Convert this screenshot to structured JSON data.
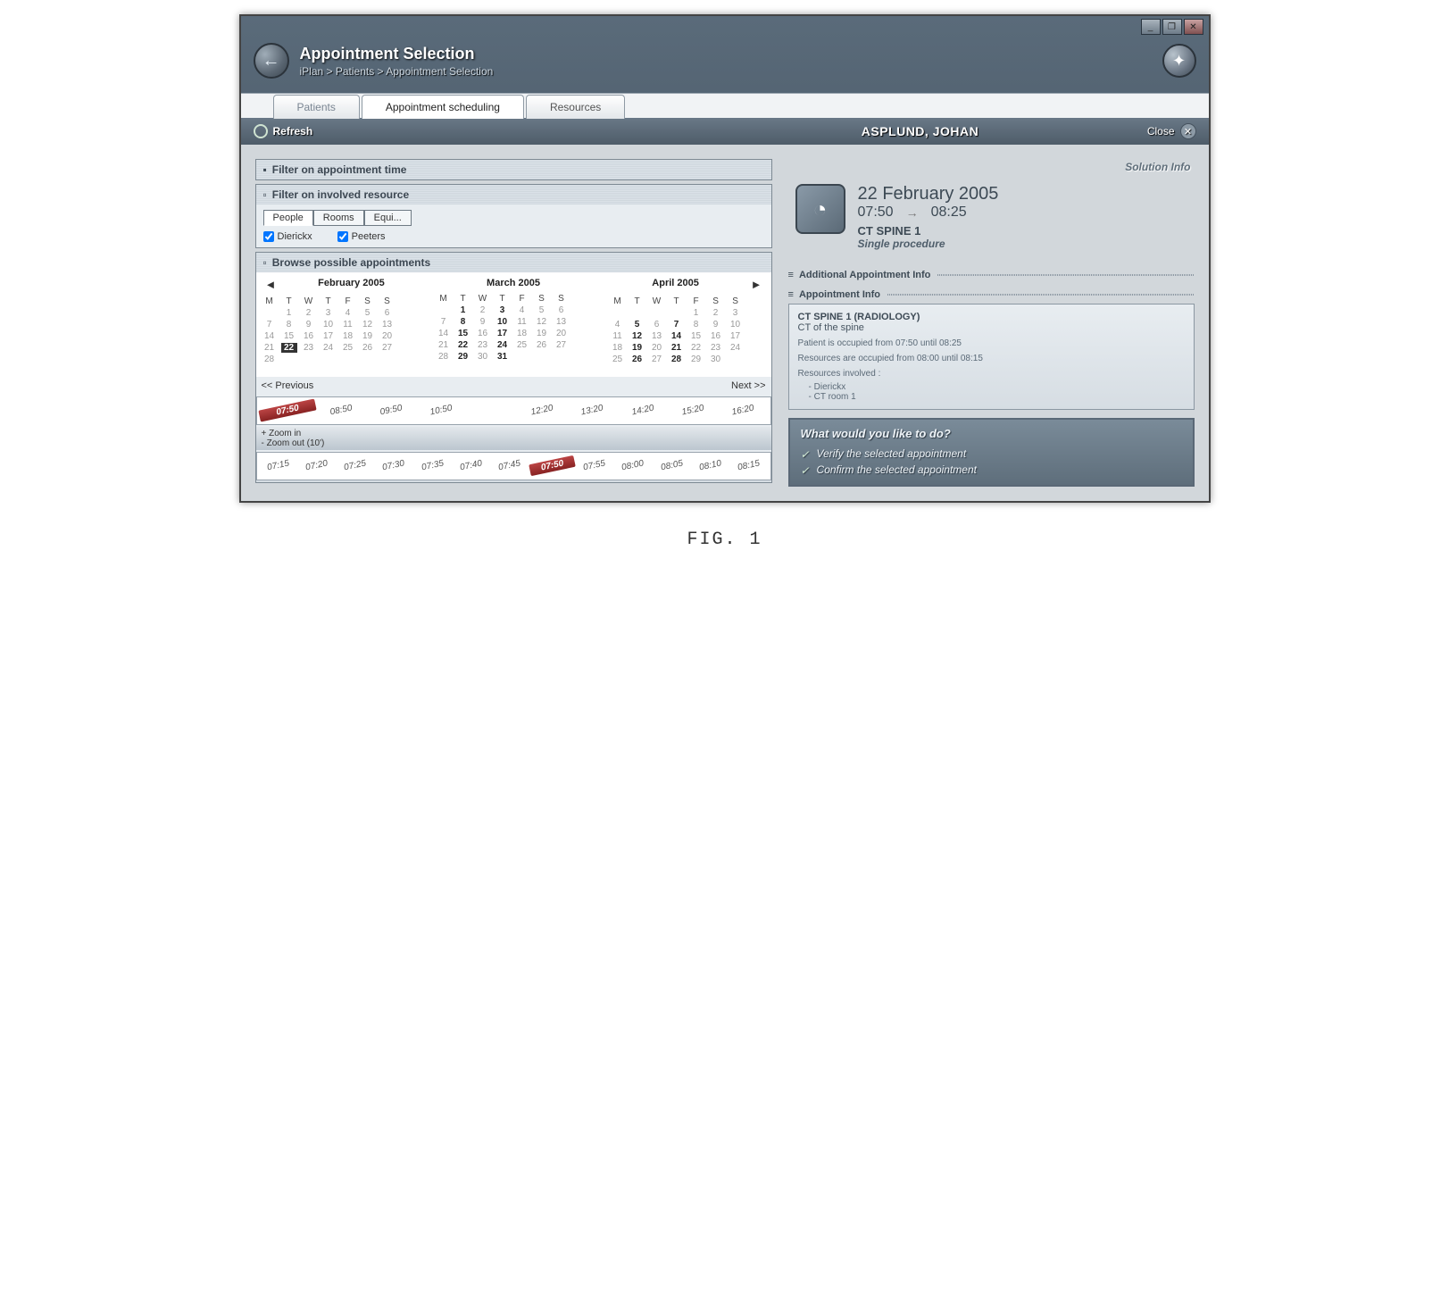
{
  "window": {
    "min": "_",
    "max": "❐",
    "close": "✕"
  },
  "header": {
    "title": "Appointment Selection",
    "breadcrumb": "iPlan > Patients > Appointment Selection"
  },
  "tabs": {
    "t1": "Patients",
    "t2": "Appointment scheduling",
    "t3": "Resources"
  },
  "toolbar": {
    "refresh": "Refresh",
    "patient": "ASPLUND, JOHAN",
    "close": "Close"
  },
  "filters": {
    "time_head": "Filter on appointment time",
    "res_head": "Filter on involved resource",
    "res_tabs": {
      "people": "People",
      "rooms": "Rooms",
      "equi": "Equi..."
    },
    "chk1": "Dierickx",
    "chk2": "Peeters",
    "browse_head": "Browse possible appointments"
  },
  "cal": {
    "prev": "◄",
    "next": "►",
    "dh": [
      "M",
      "T",
      "W",
      "T",
      "F",
      "S",
      "S"
    ],
    "feb": {
      "title": "February 2005",
      "rows": [
        [
          "",
          "1",
          "2",
          "3",
          "4",
          "5",
          "6"
        ],
        [
          "7",
          "8",
          "9",
          "10",
          "11",
          "12",
          "13"
        ],
        [
          "14",
          "15",
          "16",
          "17",
          "18",
          "19",
          "20"
        ],
        [
          "21",
          "22",
          "23",
          "24",
          "25",
          "26",
          "27"
        ],
        [
          "28",
          "",
          "",
          "",
          "",
          "",
          ""
        ]
      ],
      "sel": "22"
    },
    "mar": {
      "title": "March 2005",
      "rows": [
        [
          "",
          "1",
          "2",
          "3",
          "4",
          "5",
          "6"
        ],
        [
          "7",
          "8",
          "9",
          "10",
          "11",
          "12",
          "13"
        ],
        [
          "14",
          "15",
          "16",
          "17",
          "18",
          "19",
          "20"
        ],
        [
          "21",
          "22",
          "23",
          "24",
          "25",
          "26",
          "27"
        ],
        [
          "28",
          "29",
          "30",
          "31",
          "",
          "",
          ""
        ]
      ],
      "bold": [
        "1",
        "3",
        "8",
        "10",
        "15",
        "17",
        "22",
        "24",
        "29",
        "31"
      ]
    },
    "apr": {
      "title": "April 2005",
      "rows": [
        [
          "",
          "",
          "",
          "",
          "1",
          "2",
          "3"
        ],
        [
          "4",
          "5",
          "6",
          "7",
          "8",
          "9",
          "10"
        ],
        [
          "11",
          "12",
          "13",
          "14",
          "15",
          "16",
          "17"
        ],
        [
          "18",
          "19",
          "20",
          "21",
          "22",
          "23",
          "24"
        ],
        [
          "25",
          "26",
          "27",
          "28",
          "29",
          "30",
          ""
        ]
      ],
      "bold": [
        "5",
        "7",
        "12",
        "14",
        "19",
        "21",
        "26",
        "28"
      ]
    }
  },
  "timebar": {
    "prev": "<< Previous",
    "next": "Next >>",
    "top": [
      "07:50",
      "08:50",
      "09:50",
      "10:50",
      "",
      "12:20",
      "13:20",
      "14:20",
      "15:20",
      "16:20"
    ],
    "top_sel": "07:50",
    "zoom_in": "+ Zoom in",
    "zoom_out": "- Zoom out (10')",
    "bot": [
      "07:15",
      "07:20",
      "07:25",
      "07:30",
      "07:35",
      "07:40",
      "07:45",
      "07:50",
      "07:55",
      "08:00",
      "08:05",
      "08:10",
      "08:15"
    ],
    "bot_sel": "07:50"
  },
  "right": {
    "solution_info": "Solution Info",
    "date": "22 February 2005",
    "start": "07:50",
    "arrow": "→",
    "end": "08:25",
    "procedure": "CT SPINE 1",
    "proc_type": "Single procedure",
    "sec1": "Additional Appointment Info",
    "sec2": "Appointment Info",
    "info": {
      "h1": "CT SPINE 1 (RADIOLOGY)",
      "h2": "CT of the spine",
      "l1": "Patient is occupied from 07:50 until 08:25",
      "l2": "Resources are occupied from 08:00 until 08:15",
      "l3": "Resources involved :",
      "r1": "- Dierickx",
      "r2": "- CT room 1"
    }
  },
  "cta": {
    "title": "What would you like to do?",
    "a1": "Verify the selected appointment",
    "a2": "Confirm the selected appointment"
  },
  "figure": "FIG. 1"
}
